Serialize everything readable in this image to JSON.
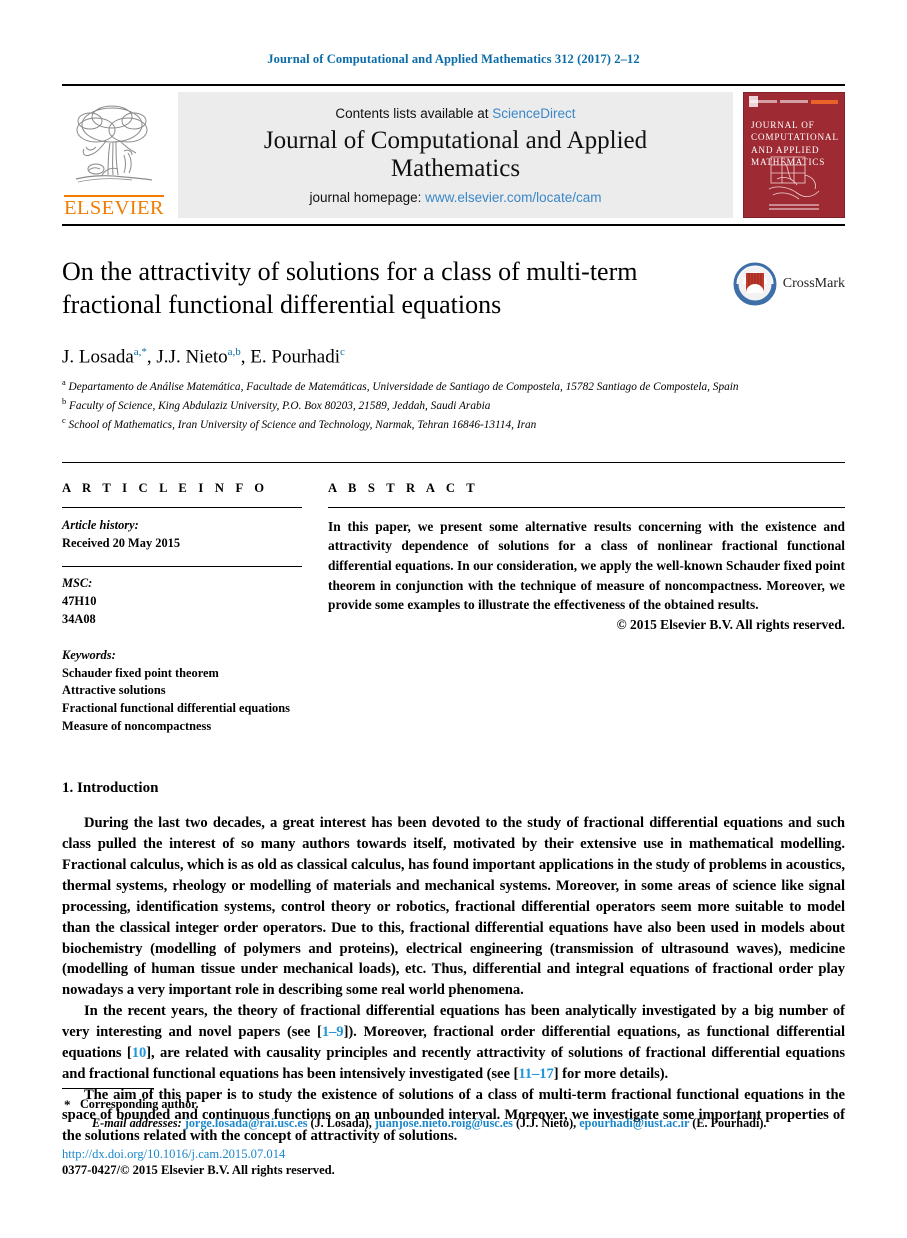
{
  "running_head": "Journal of Computational and Applied Mathematics 312 (2017) 2–12",
  "masthead": {
    "publisher": "ELSEVIER",
    "contents_prefix": "Contents lists available at",
    "contents_link": "ScienceDirect",
    "journal_title": "Journal of Computational and Applied Mathematics",
    "homepage_prefix": "journal homepage:",
    "homepage_link": "www.elsevier.com/locate/cam",
    "cover_title": "JOURNAL OF COMPUTATIONAL AND APPLIED MATHEMATICS"
  },
  "article": {
    "title": "On the attractivity of solutions for a class of multi-term fractional functional differential equations",
    "crossmark_label": "CrossMark",
    "authors": "J. Losada a,*, J.J. Nieto a,b, E. Pourhadi c",
    "authors_parts": [
      {
        "name": "J. Losada",
        "marks": "a,*"
      },
      {
        "name": "J.J. Nieto",
        "marks": "a,b"
      },
      {
        "name": "E. Pourhadi",
        "marks": "c"
      }
    ],
    "affiliations": [
      {
        "mark": "a",
        "text": "Departamento de Análise Matemática, Facultade de Matemáticas, Universidade de Santiago de Compostela, 15782 Santiago de Compostela, Spain"
      },
      {
        "mark": "b",
        "text": "Faculty of Science, King Abdulaziz University, P.O. Box 80203, 21589, Jeddah, Saudi Arabia"
      },
      {
        "mark": "c",
        "text": "School of Mathematics, Iran University of Science and Technology, Narmak, Tehran 16846-13114, Iran"
      }
    ]
  },
  "article_info": {
    "heading": "A R T I C L E   I N F O",
    "history_label": "Article history:",
    "history_lines": [
      "Received 20 May 2015"
    ],
    "msc_label": "MSC:",
    "msc_codes": [
      "47H10",
      "34A08"
    ],
    "keywords_label": "Keywords:",
    "keywords": [
      "Schauder fixed point theorem",
      "Attractive solutions",
      "Fractional functional differential equations",
      "Measure of noncompactness"
    ]
  },
  "abstract": {
    "heading": "A B S T R A C T",
    "text": "In this paper, we present some alternative results concerning with the existence and attractivity dependence of solutions for a class of nonlinear fractional functional differential equations. In our consideration, we apply the well-known Schauder fixed point theorem in conjunction with the technique of measure of noncompactness. Moreover, we provide some examples to illustrate the effectiveness of the obtained results.",
    "copyright": "© 2015 Elsevier B.V. All rights reserved."
  },
  "introduction": {
    "number_and_title": "1. Introduction",
    "paragraph_1": "During the last two decades, a great interest has been devoted to the study of fractional differential equations and such class pulled the interest of so many authors towards itself, motivated by their extensive use in mathematical modelling. Fractional calculus, which is as old as classical calculus, has found important applications in the study of problems in acoustics, thermal systems, rheology or modelling of materials and mechanical systems. Moreover, in some areas of science like signal processing, identification systems, control theory or robotics, fractional differential operators seem more suitable to model than the classical integer order operators. Due to this, fractional differential equations have also been used in models about biochemistry (modelling of polymers and proteins), electrical engineering (transmission of ultrasound waves), medicine (modelling of human tissue under mechanical loads), etc. Thus, differential and integral equations of fractional order play nowadays a very important role in describing some real world phenomena.",
    "paragraph_2_a": "In the recent years, the theory of fractional differential equations has been analytically investigated by a big number of very interesting and novel papers (see [",
    "paragraph_2_cite1": "1–9",
    "paragraph_2_b": "]). Moreover, fractional order differential equations, as functional differential equations [",
    "paragraph_2_cite2": "10",
    "paragraph_2_c": "], are related with causality principles and recently attractivity of solutions of fractional differential equations and fractional functional equations has been intensively investigated (see [",
    "paragraph_2_cite3": "11–17",
    "paragraph_2_d": "] for more details).",
    "paragraph_3": "The aim of this paper is to study the existence of solutions of a class of multi-term fractional functional equations in the space of bounded and continuous functions on an unbounded interval. Moreover, we investigate some important properties of the solutions related with the concept of attractivity of solutions."
  },
  "footer": {
    "corresponding_author": "Corresponding author.",
    "email_label": "E-mail addresses:",
    "emails": [
      {
        "address": "jorge.losada@rai.usc.es",
        "owner": "(J. Losada)"
      },
      {
        "address": "juanjose.nieto.roig@usc.es",
        "owner": "(J.J. Nieto)"
      },
      {
        "address": "epourhadi@iust.ac.ir",
        "owner": "(E. Pourhadi)"
      }
    ],
    "doi": "http://dx.doi.org/10.1016/j.cam.2015.07.014",
    "issn_line": "0377-0427/© 2015 Elsevier B.V. All rights reserved."
  }
}
